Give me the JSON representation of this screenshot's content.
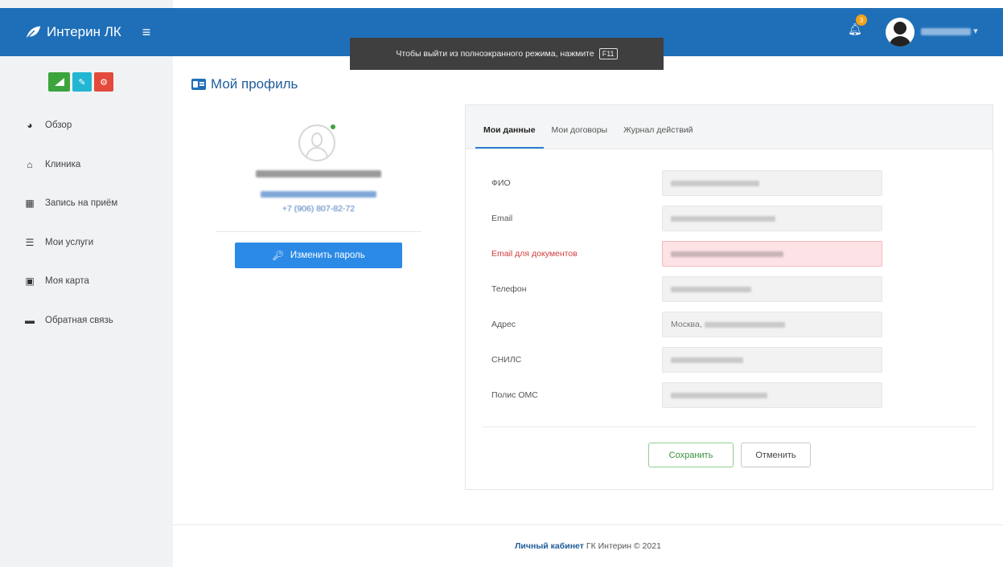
{
  "brand": {
    "name": "Интерин ЛК"
  },
  "fullscreen_hint": {
    "text": "Чтобы выйти из полноэкранного режима, нажмите",
    "key": "F11"
  },
  "notifications": {
    "count": "3"
  },
  "user": {
    "menu_caret": "▾"
  },
  "sidebar": {
    "items": [
      {
        "label": "Обзор",
        "icon": "pie-chart-icon"
      },
      {
        "label": "Клиника",
        "icon": "home-icon"
      },
      {
        "label": "Запись на приём",
        "icon": "calendar-icon"
      },
      {
        "label": "Мои услуги",
        "icon": "list-icon"
      },
      {
        "label": "Моя карта",
        "icon": "book-icon"
      },
      {
        "label": "Обратная связь",
        "icon": "comment-icon"
      }
    ]
  },
  "page": {
    "title": "Мой профиль"
  },
  "profile": {
    "phone": "+7 (906) 807-82-72",
    "change_password_label": "Изменить пароль"
  },
  "tabs": [
    {
      "label": "Мои данные",
      "active": true
    },
    {
      "label": "Мои договоры",
      "active": false
    },
    {
      "label": "Журнал действий",
      "active": false
    }
  ],
  "form": {
    "fields": [
      {
        "label": "ФИО"
      },
      {
        "label": "Email"
      },
      {
        "label": "Email для документов",
        "error": true
      },
      {
        "label": "Телефон"
      },
      {
        "label": "Адрес",
        "value_prefix": "Москва, "
      },
      {
        "label": "СНИЛС"
      },
      {
        "label": "Полис ОМС"
      }
    ],
    "save_label": "Сохранить",
    "cancel_label": "Отменить"
  },
  "footer": {
    "link": "Личный кабинет",
    "text": "ГК Интерин © 2021"
  },
  "colors": {
    "brand_blue": "#1f6fb8",
    "button_blue": "#2b8ae6",
    "error_red": "#d23b3b",
    "success_green": "#3ca43c"
  }
}
